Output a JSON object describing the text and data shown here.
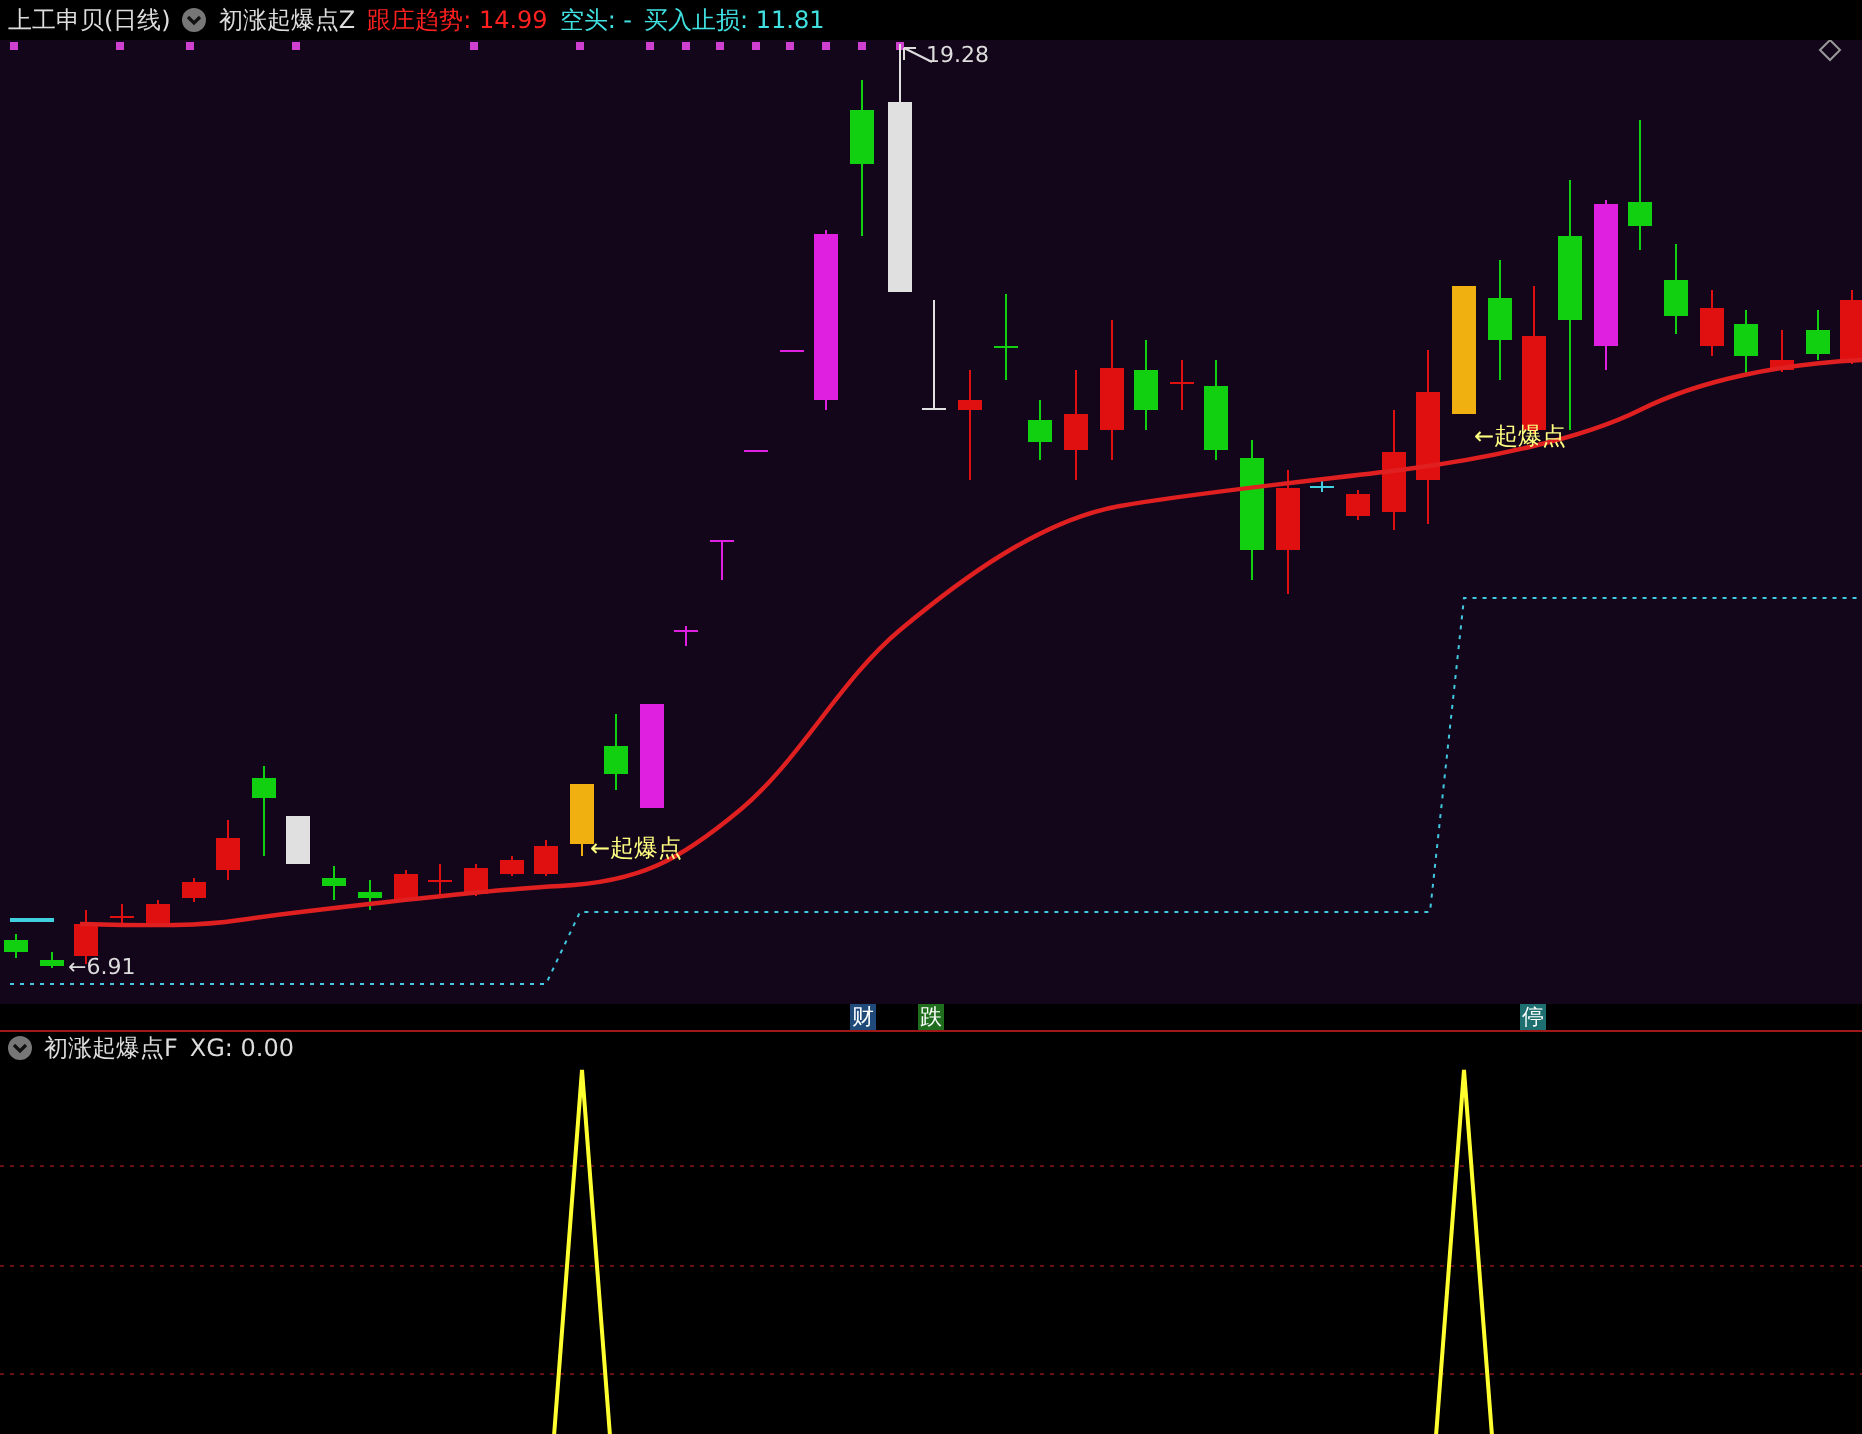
{
  "header": {
    "title": "上工申贝(日线)",
    "indicator": "初涨起爆点Z",
    "readings": [
      {
        "text": "跟庄趋势: 14.99",
        "color": "#ff2020"
      },
      {
        "text": "空头: -",
        "color": "#40e0e0"
      },
      {
        "text": "买入止损: 11.81",
        "color": "#40e0e0"
      }
    ]
  },
  "main_chart": {
    "high_label": "19.28",
    "low_label": "←6.91",
    "signals": [
      {
        "text": "←起爆点"
      },
      {
        "text": "←起爆点"
      }
    ]
  },
  "event_markers": [
    {
      "text": "财",
      "color": "#1f4a7a"
    },
    {
      "text": "跌",
      "color": "#1e6e1e"
    },
    {
      "text": "停",
      "color": "#1e7070"
    }
  ],
  "sub_panel": {
    "indicator": "初涨起爆点F",
    "readings": [
      {
        "text": "XG: 0.00"
      }
    ]
  }
}
